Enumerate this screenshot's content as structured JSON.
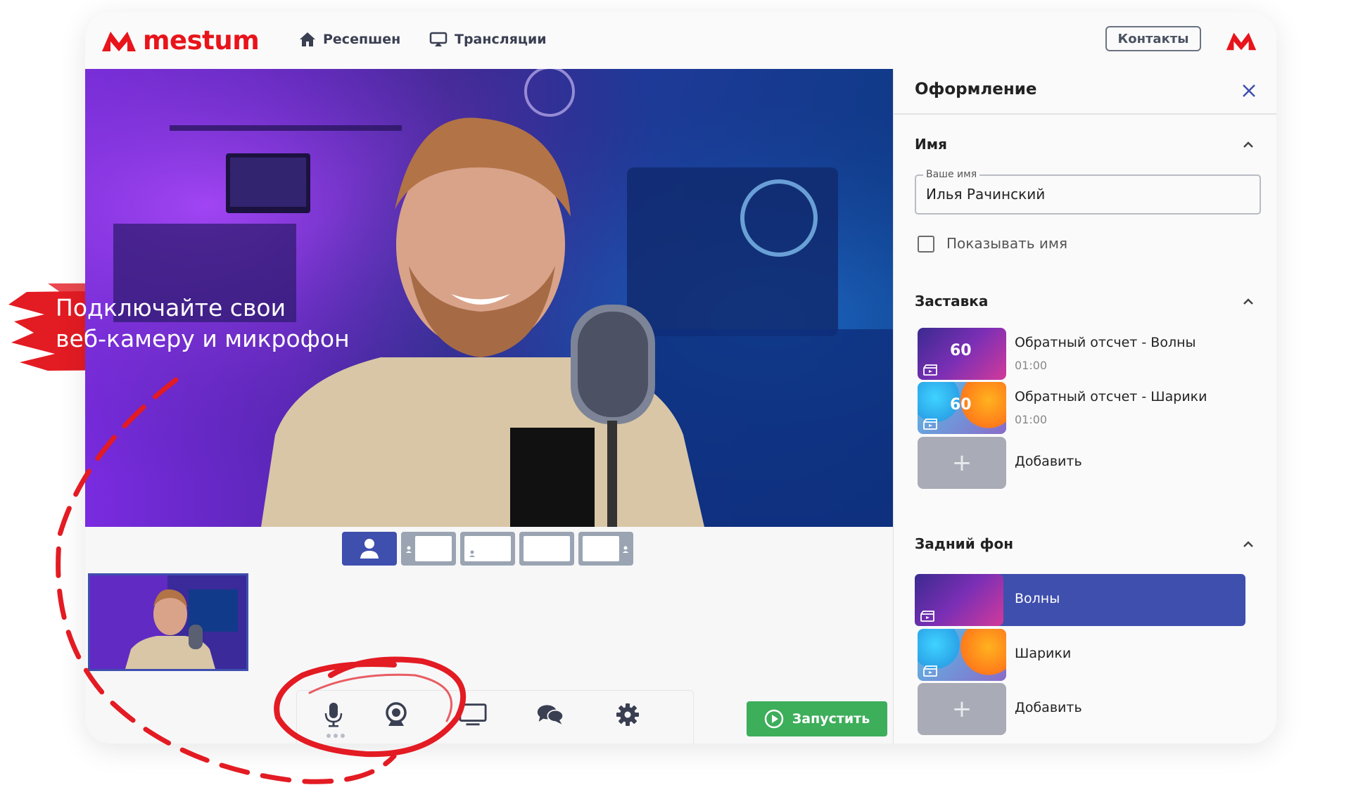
{
  "header": {
    "logo_text": "mestum",
    "nav": [
      {
        "label": "Ресепшен",
        "icon": "home-icon"
      },
      {
        "label": "Трансляции",
        "icon": "cast-icon"
      }
    ],
    "contacts_label": "Контакты"
  },
  "promo": {
    "line1": "Подключайте свои",
    "line2": "веб-камеру и микрофон"
  },
  "stage": {
    "layouts": [
      "single",
      "left-small",
      "bottom-left",
      "blank",
      "right-small"
    ],
    "active_layout": 0
  },
  "controls": {
    "items": [
      "microphone-icon",
      "webcam-icon",
      "screen-share-icon",
      "chat-icon",
      "settings-icon"
    ],
    "start_label": "Запустить"
  },
  "panel": {
    "title": "Оформление",
    "name_section": {
      "title": "Имя",
      "field_legend": "Ваше имя",
      "field_value": "Илья Рачинский",
      "show_name_label": "Показывать имя",
      "show_name_checked": false
    },
    "intro_section": {
      "title": "Заставка",
      "items": [
        {
          "title": "Обратный отсчет - Волны",
          "duration": "01:00",
          "badge": "60"
        },
        {
          "title": "Обратный отсчет - Шарики",
          "duration": "01:00",
          "badge": "60"
        }
      ],
      "add_label": "Добавить"
    },
    "background_section": {
      "title": "Задний фон",
      "items": [
        {
          "title": "Волны",
          "selected": true
        },
        {
          "title": "Шарики",
          "selected": false
        }
      ],
      "add_label": "Добавить"
    }
  },
  "colors": {
    "brand_red": "#e8141b",
    "accent_blue": "#3f4fae",
    "start_green": "#3dae5a"
  }
}
